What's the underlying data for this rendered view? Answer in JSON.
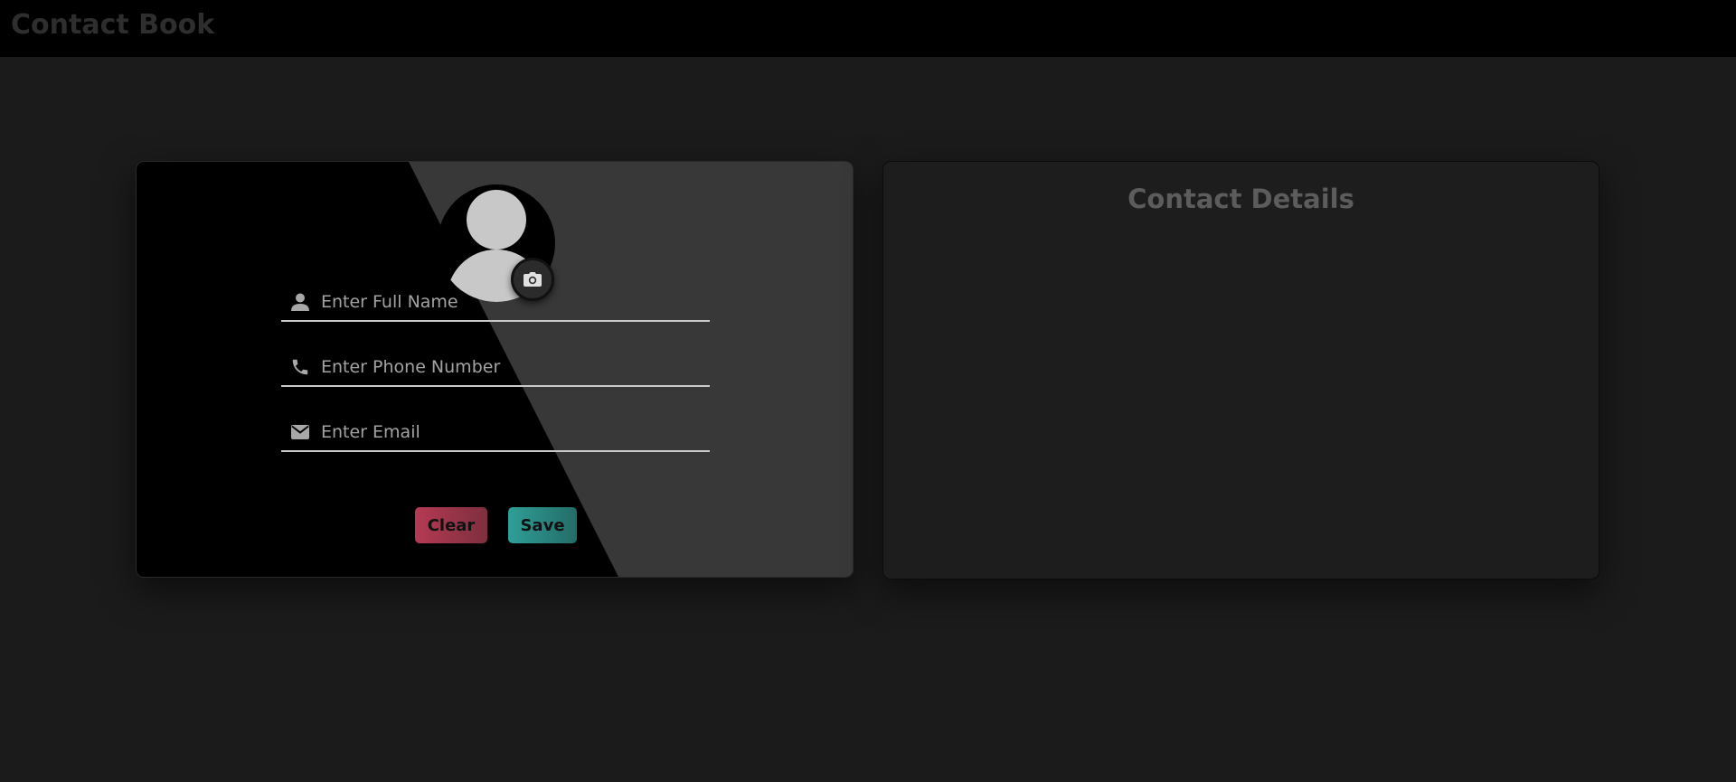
{
  "header": {
    "title": "Contact Book"
  },
  "form": {
    "avatar_icon": "user-avatar",
    "camera_icon": "camera-icon",
    "name_placeholder": "Enter Full Name",
    "phone_placeholder": "Enter Phone Number",
    "email_placeholder": "Enter Email",
    "name_value": "",
    "phone_value": "",
    "email_value": "",
    "clear_label": "Clear",
    "save_label": "Save"
  },
  "details": {
    "title": "Contact Details"
  },
  "colors": {
    "background": "#1b1b1b",
    "header": "#000000",
    "clear_button": "#b43a53",
    "save_button": "#2f9e97"
  }
}
